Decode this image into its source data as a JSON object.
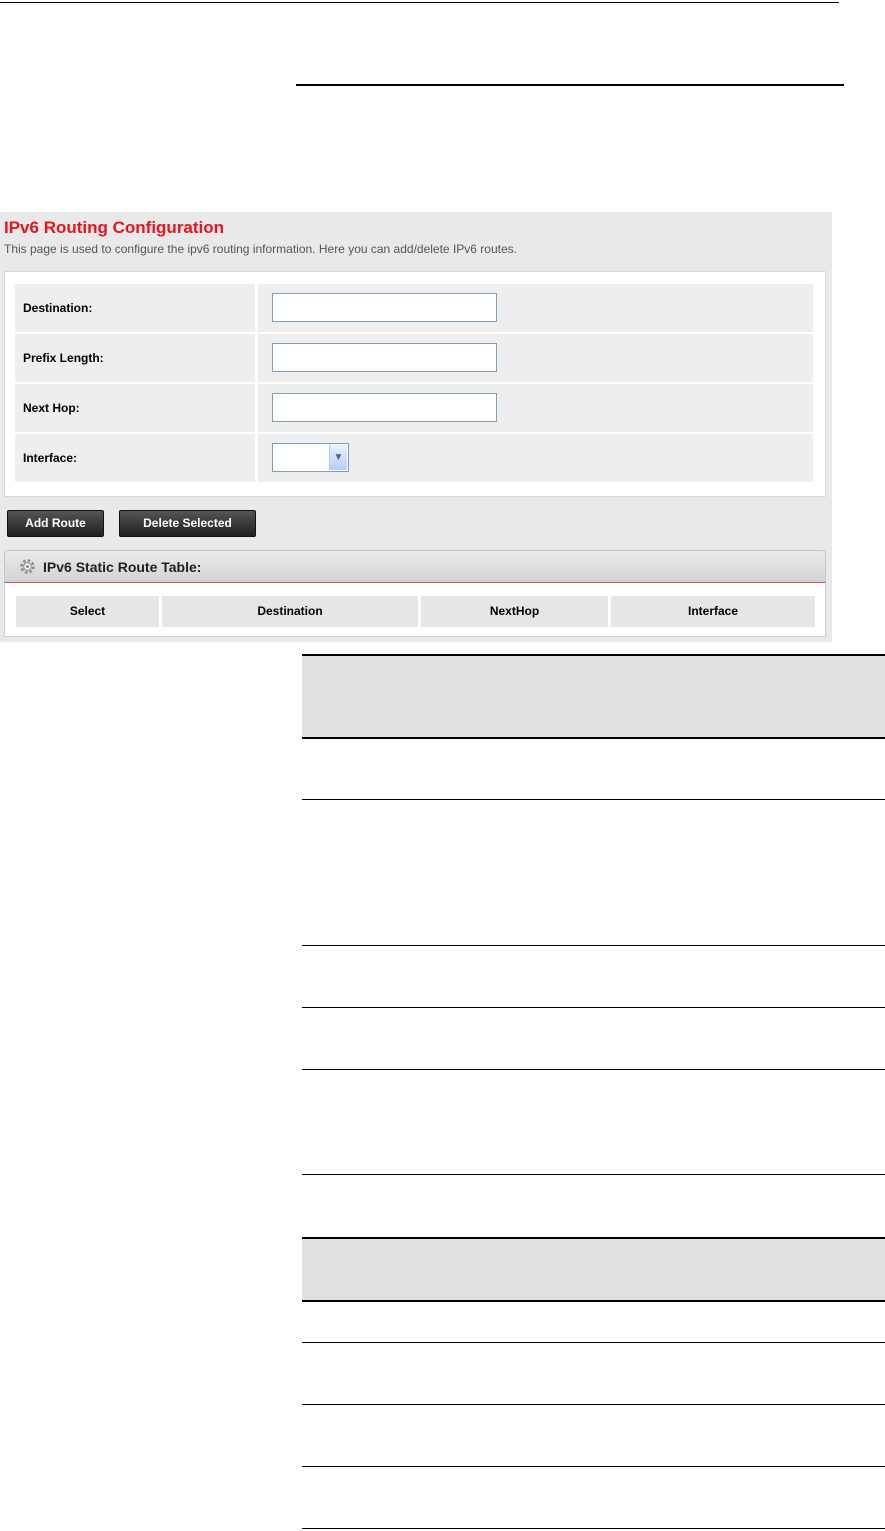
{
  "panel": {
    "title": "IPv6 Routing Configuration",
    "description": "This page is used to configure the ipv6 routing information. Here you can add/delete IPv6 routes."
  },
  "form": {
    "destination_label": "Destination:",
    "destination_value": "",
    "prefix_length_label": "Prefix Length:",
    "prefix_length_value": "",
    "next_hop_label": "Next Hop:",
    "next_hop_value": "",
    "interface_label": "Interface:",
    "interface_value": ""
  },
  "buttons": {
    "add_route": "Add Route",
    "delete_selected": "Delete Selected"
  },
  "route_table": {
    "title": "IPv6 Static Route Table:",
    "columns": [
      "Select",
      "Destination",
      "NextHop",
      "Interface"
    ]
  },
  "icons": {
    "table_header_icon": "gear-icon",
    "select_arrow": "chevron-down-icon"
  },
  "colors": {
    "title_red": "#e8141c",
    "button_dark": "#2a2a2a",
    "panel_bg": "#e9e9e9"
  }
}
